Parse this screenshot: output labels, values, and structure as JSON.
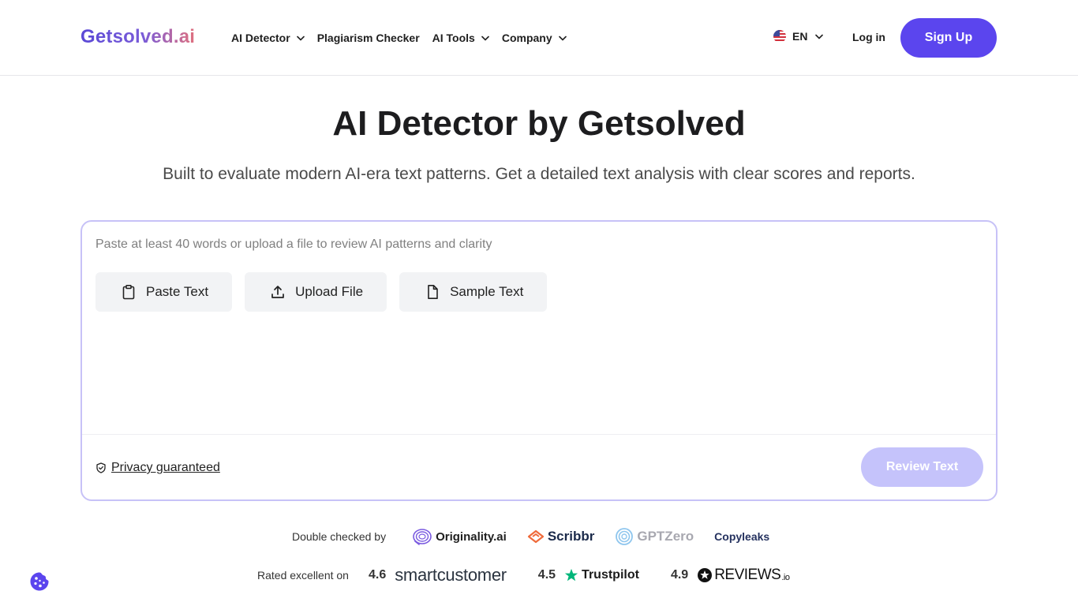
{
  "header": {
    "logo": "Getsolved.ai",
    "nav": [
      {
        "label": "AI Detector",
        "has_dropdown": true
      },
      {
        "label": "Plagiarism Checker",
        "has_dropdown": false
      },
      {
        "label": "AI Tools",
        "has_dropdown": true
      },
      {
        "label": "Company",
        "has_dropdown": true
      }
    ],
    "language": "EN",
    "language_icon": "us-flag-icon",
    "login_label": "Log in",
    "signup_label": "Sign Up"
  },
  "hero": {
    "title": "AI Detector by Getsolved",
    "subtitle": "Built to evaluate modern AI-era text patterns. Get a detailed text analysis with clear scores and reports."
  },
  "editor": {
    "placeholder": "Paste at least 40 words or upload a file to review AI patterns and clarity",
    "text_value": "",
    "actions": [
      {
        "label": "Paste Text",
        "icon": "clipboard-icon"
      },
      {
        "label": "Upload File",
        "icon": "upload-icon"
      },
      {
        "label": "Sample Text",
        "icon": "document-icon"
      }
    ],
    "privacy_label": "Privacy guaranteed",
    "review_label": "Review Text"
  },
  "trust": {
    "checked_label": "Double checked by",
    "partners": [
      "Originality.ai",
      "Scribbr",
      "GPTZero",
      "Copyleaks"
    ],
    "rated_label": "Rated excellent on",
    "ratings": [
      {
        "score": "4.6",
        "brand": "smartcustomer"
      },
      {
        "score": "4.5",
        "brand": "Trustpilot"
      },
      {
        "score": "4.9",
        "brand": "REVIEWS",
        "suffix": ".io"
      }
    ]
  },
  "colors": {
    "accent": "#5b45ee",
    "review_disabled": "#c5c3fb",
    "card_border": "#c7c2f7",
    "trustpilot_green": "#00b67a"
  }
}
